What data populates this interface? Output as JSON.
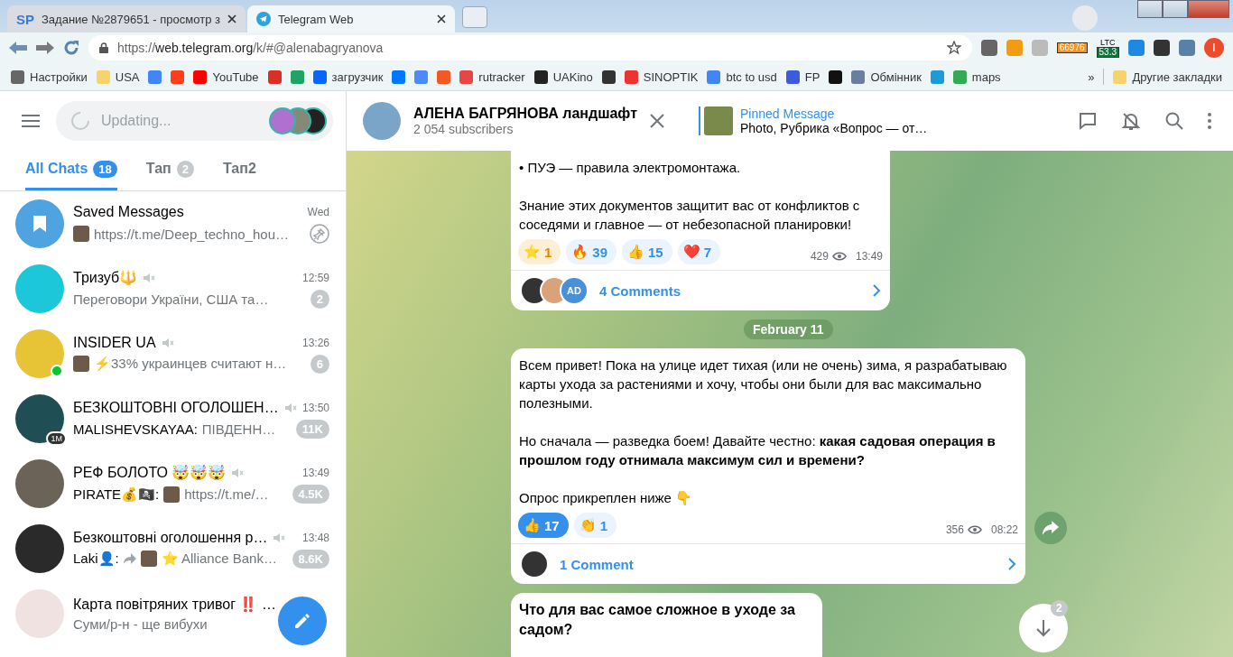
{
  "browser": {
    "tabs": [
      {
        "logo": "SP",
        "title": "Задание №2879651 - просмотр з",
        "selected": false
      },
      {
        "title": "Telegram Web",
        "selected": true
      }
    ],
    "url": {
      "scheme": "https://",
      "host": "web.telegram.org",
      "path": "/k/#@alenabagryanova"
    },
    "btc_badge": "66976",
    "ltc_label": "LTC",
    "ltc_badge": "53.3",
    "profile_initial": "I",
    "bookmarks": [
      {
        "kind": "link",
        "label": "Настройки"
      },
      {
        "kind": "link",
        "label": "USA"
      },
      {
        "kind": "icon"
      },
      {
        "kind": "icon"
      },
      {
        "kind": "link",
        "label": "YouTube"
      },
      {
        "kind": "icon"
      },
      {
        "kind": "icon"
      },
      {
        "kind": "link",
        "label": "загрузчик"
      },
      {
        "kind": "icon"
      },
      {
        "kind": "icon"
      },
      {
        "kind": "icon"
      },
      {
        "kind": "link",
        "label": "rutracker"
      },
      {
        "kind": "link",
        "label": "UAKino"
      },
      {
        "kind": "icon"
      },
      {
        "kind": "link",
        "label": "SINOPTIK"
      },
      {
        "kind": "link",
        "label": "btc to usd"
      },
      {
        "kind": "link",
        "label": "FP"
      },
      {
        "kind": "icon"
      },
      {
        "kind": "link",
        "label": "Обмінник"
      },
      {
        "kind": "icon"
      },
      {
        "kind": "link",
        "label": "maps"
      }
    ],
    "bookmarks_overflow": "»",
    "other_bookmarks": "Другие закладки"
  },
  "sidebar": {
    "search": {
      "placeholder": "Updating..."
    },
    "folders": [
      {
        "label": "All Chats",
        "count": "18",
        "selected": true
      },
      {
        "label": "Тап",
        "count": "2",
        "selected": false
      },
      {
        "label": "Тап2",
        "selected": false
      }
    ],
    "chats": [
      {
        "name": "Saved Messages",
        "kind": "saved",
        "time": "Wed",
        "thumb": true,
        "preview": "https://t.me/Deep_techno_hou…",
        "pinned": true,
        "muted": false
      },
      {
        "name": "Тризуб🔱",
        "time": "12:59",
        "preview": "Переговори України, США та…",
        "count": "2",
        "muted": true
      },
      {
        "name": "INSIDER UA",
        "time": "13:26",
        "thumb": true,
        "preview": "⚡33% украинцев считают н…",
        "count": "6",
        "muted": true,
        "online": true
      },
      {
        "name": "БЕЗКОШТОВНІ ОГОЛОШЕН…",
        "time": "13:50",
        "avatar_badge": "1M",
        "sender": "MALISHEVSKAYAA:",
        "preview": "ПІВДЕНН…",
        "count": "11K",
        "muted": true
      },
      {
        "name": "РЕФ БОЛОТО 🤯🤯🤯",
        "time": "13:49",
        "sender": "PIRATE💰🏴‍☠️:",
        "thumb": true,
        "preview": "https://t.me/…",
        "count": "4.5K",
        "muted": true
      },
      {
        "name": "Безкоштовні оголошення р…",
        "time": "13:48",
        "sender": "Laki👤:",
        "forwarded": true,
        "thumb": true,
        "preview": "⭐ Alliance Bank…",
        "count": "8.6K",
        "muted": true
      },
      {
        "name": "Карта повітряних тривог ‼️ …",
        "preview": "Суми/р-н - ще вибухи",
        "muted": false
      }
    ]
  },
  "chat": {
    "title": "АЛЕНА БАГРЯНОВА ландшафт",
    "subtitle": "2 054 subscribers",
    "pinned": {
      "label": "Pinned Message",
      "text": "Photo, Рубрика «Вопрос — от…"
    },
    "messages": [
      {
        "kind": "post",
        "paragraphs": [
          "• ПУЭ — правила электромонтажа.",
          "Знание этих документов защитит вас от конфликтов с соседями и главное — от небезопасной планировки!"
        ],
        "reactions": [
          {
            "kind": "paid",
            "emoji": "⭐",
            "count": "1",
            "selected": false
          },
          {
            "emoji": "🔥",
            "count": "39",
            "selected": false
          },
          {
            "emoji": "👍",
            "count": "15",
            "selected": false
          },
          {
            "emoji": "❤️",
            "count": "7",
            "selected": false
          }
        ],
        "views": "429",
        "time": "13:49",
        "comments": "4 Comments",
        "commenters": [
          {
            "kind": "photo"
          },
          {
            "kind": "photo"
          },
          {
            "kind": "initials",
            "initials": "AD"
          }
        ]
      },
      {
        "kind": "date",
        "text": "February 11"
      },
      {
        "kind": "post",
        "paragraphs": [
          "Всем привет! Пока на улице идет тихая (или не очень) зима, я разрабатываю карты ухода за растениями и хочу, чтобы они были для вас максимально полезными.",
          "Но сначала — разведка боем! Давайте честно: **какая садовая операция в прошлом году отнимала максимум сил и времени?**",
          "Опрос прикреплен ниже 👇"
        ],
        "reactions": [
          {
            "emoji": "👍",
            "count": "17",
            "selected": true
          },
          {
            "emoji": "👏",
            "count": "1",
            "selected": false
          }
        ],
        "views": "356",
        "time": "08:22",
        "comments": "1 Comment",
        "commenters": [
          {
            "kind": "photo"
          }
        ]
      },
      {
        "kind": "poll",
        "question": "Что для вас самое сложное в уходе за садом?"
      }
    ],
    "unread_below": "2"
  }
}
